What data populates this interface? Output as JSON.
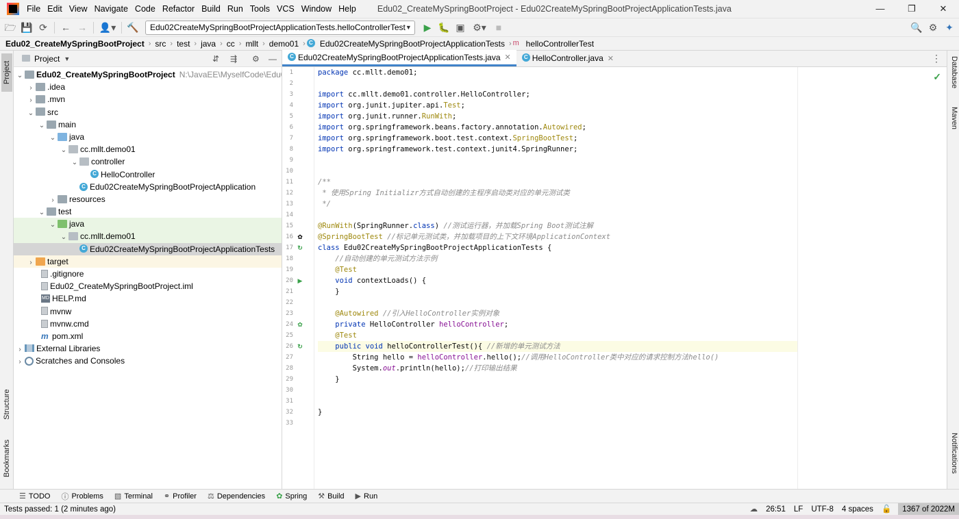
{
  "menubar": {
    "items": [
      "File",
      "Edit",
      "View",
      "Navigate",
      "Code",
      "Refactor",
      "Build",
      "Run",
      "Tools",
      "VCS",
      "Window",
      "Help"
    ],
    "title": "Edu02_CreateMySpringBootProject - Edu02CreateMySpringBootProjectApplicationTests.java"
  },
  "toolbar": {
    "run_config": "Edu02CreateMySpringBootProjectApplicationTests.helloControllerTest"
  },
  "navbar": {
    "crumbs": [
      "Edu02_CreateMySpringBootProject",
      "src",
      "test",
      "java",
      "cc",
      "mllt",
      "demo01",
      "Edu02CreateMySpringBootProjectApplicationTests",
      "helloControllerTest"
    ]
  },
  "left_strip": {
    "project": "Project",
    "structure": "Structure",
    "bookmarks": "Bookmarks"
  },
  "right_strip": {
    "database": "Database",
    "maven": "Maven",
    "notifications": "Notifications"
  },
  "project_panel": {
    "title": "Project",
    "root": "Edu02_CreateMySpringBootProject",
    "root_path": "N:\\JavaEE\\MyselfCode\\Edu02_Crea",
    "tree": [
      {
        "label": ".idea"
      },
      {
        "label": ".mvn"
      },
      {
        "label": "src"
      },
      {
        "label": "main"
      },
      {
        "label": "java"
      },
      {
        "label": "cc.mllt.demo01"
      },
      {
        "label": "controller"
      },
      {
        "label": "HelloController"
      },
      {
        "label": "Edu02CreateMySpringBootProjectApplication"
      },
      {
        "label": "resources"
      },
      {
        "label": "test"
      },
      {
        "label": "java"
      },
      {
        "label": "cc.mllt.demo01"
      },
      {
        "label": "Edu02CreateMySpringBootProjectApplicationTests"
      },
      {
        "label": "target"
      },
      {
        "label": ".gitignore"
      },
      {
        "label": "Edu02_CreateMySpringBootProject.iml"
      },
      {
        "label": "HELP.md"
      },
      {
        "label": "mvnw"
      },
      {
        "label": "mvnw.cmd"
      },
      {
        "label": "pom.xml"
      },
      {
        "label": "External Libraries"
      },
      {
        "label": "Scratches and Consoles"
      }
    ]
  },
  "editor": {
    "tabs": [
      {
        "label": "Edu02CreateMySpringBootProjectApplicationTests.java"
      },
      {
        "label": "HelloController.java"
      }
    ],
    "line_numbers": [
      "1",
      "2",
      "3",
      "4",
      "5",
      "6",
      "7",
      "8",
      "9",
      "10",
      "11",
      "12",
      "13",
      "14",
      "15",
      "16",
      "17",
      "18",
      "19",
      "20",
      "21",
      "22",
      "23",
      "24",
      "25",
      "26",
      "27",
      "28",
      "29",
      "30",
      "31",
      "32",
      "33"
    ],
    "code": {
      "l1": "package cc.mllt.demo01;",
      "l3a": "import",
      "l3b": " cc.mllt.demo01.controller.HelloController;",
      "l4a": "import",
      "l4b": " org.junit.jupiter.api.",
      "l4c": "Test",
      "l4d": ";",
      "l5a": "import",
      "l5b": " org.junit.runner.",
      "l5c": "RunWith",
      "l5d": ";",
      "l6a": "import",
      "l6b": " org.springframework.beans.factory.annotation.",
      "l6c": "Autowired",
      "l6d": ";",
      "l7a": "import",
      "l7b": " org.springframework.boot.test.context.",
      "l7c": "SpringBootTest",
      "l7d": ";",
      "l8a": "import",
      "l8b": " org.springframework.test.context.junit4.SpringRunner;",
      "l11": "/**",
      "l12": " * 使用Spring Initializr方式自动创建的主程序启动类对应的单元测试类",
      "l13": " */",
      "l15a": "@RunWith",
      "l15b": "(SpringRunner.",
      "l15c": "class",
      "l15d": ") ",
      "l15e": "//测试运行器，并加载Spring Boot测试注解",
      "l16a": "@SpringBootTest",
      "l16b": " //标记单元测试类，并加载项目的上下文环境ApplicationContext",
      "l17a": "class",
      "l17b": " Edu02CreateMySpringBootProjectApplicationTests {",
      "l18": "    //自动创建的单元测试方法示例",
      "l19": "    @Test",
      "l20a": "    ",
      "l20b": "void",
      "l20c": " contextLoads() {",
      "l21": "    }",
      "l23a": "    @Autowired",
      "l23b": " //引入HelloController实例对象",
      "l24a": "    ",
      "l24b": "private",
      "l24c": " HelloController ",
      "l24d": "helloController",
      "l24e": ";",
      "l25": "    @Test",
      "l26a": "    ",
      "l26b": "public void",
      "l26c": " helloControllerTest(){ ",
      "l26d": "//新增的单元测试方法",
      "l27a": "        String hello = ",
      "l27b": "helloController",
      "l27c": ".hello();",
      "l27d": "//调用HelloController类中对应的请求控制方法hello()",
      "l28a": "        System.",
      "l28b": "out",
      "l28c": ".println(hello);",
      "l28d": "//打印输出结果",
      "l29": "    }",
      "l32": "}"
    }
  },
  "tool_tabs": [
    "TODO",
    "Problems",
    "Terminal",
    "Profiler",
    "Dependencies",
    "Spring",
    "Build",
    "Run"
  ],
  "status": {
    "message": "Tests passed: 1 (2 minutes ago)",
    "position": "26:51",
    "line_sep": "LF",
    "encoding": "UTF-8",
    "indent": "4 spaces",
    "memory": "1367 of 2022M"
  }
}
